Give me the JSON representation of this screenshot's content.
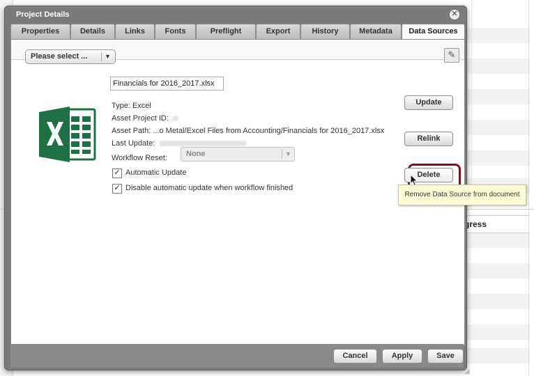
{
  "background": {
    "column_header": "gress"
  },
  "dialog": {
    "title": "Project Details",
    "close_glyph": "✕"
  },
  "tabs": [
    {
      "label": "Properties",
      "active": false
    },
    {
      "label": "Details",
      "active": false
    },
    {
      "label": "Links",
      "active": false
    },
    {
      "label": "Fonts",
      "active": false
    },
    {
      "label": "Preflight",
      "active": false
    },
    {
      "label": "Export",
      "active": false
    },
    {
      "label": "History",
      "active": false
    },
    {
      "label": "Metadata",
      "active": false
    },
    {
      "label": "Data Sources",
      "active": true
    }
  ],
  "toolbar": {
    "data_source_select": "Please select ...",
    "note_icon": "note-icon"
  },
  "data_source": {
    "icon": "excel-icon",
    "filename": "Financials for 2016_2017.xlsx",
    "type": "Type: Excel",
    "asset_project_id_label": "Asset Project ID:",
    "asset_path": "Asset Path: ...o Metal/Excel Files from Accounting/Financials for 2016_2017.xlsx",
    "last_update_label": "Last Update:",
    "workflow_reset_label": "Workflow Reset:",
    "workflow_reset_value": "None",
    "automatic_update_label": "Automatic Update",
    "automatic_update_checked": true,
    "disable_auto_update_label": "Disable automatic update when workflow finished",
    "disable_auto_update_checked": true
  },
  "actions": {
    "update_label": "Update",
    "relink_label": "Relink",
    "delete_label": "Delete",
    "delete_tooltip": "Remove Data Source from document"
  },
  "footer": {
    "cancel_label": "Cancel",
    "apply_label": "Apply",
    "save_label": "Save"
  },
  "colors": {
    "dialog_frame": "#7b7b7b",
    "highlight_border": "#7a1320",
    "excel_green": "#1e7145",
    "tooltip_bg": "#ffffd9"
  }
}
